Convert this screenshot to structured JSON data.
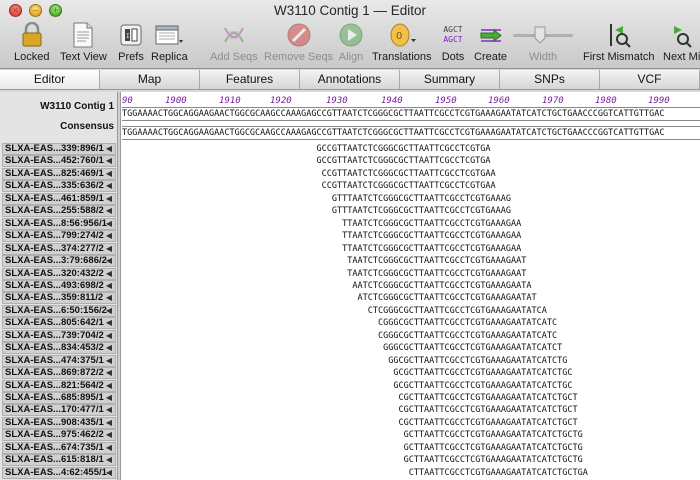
{
  "window": {
    "title": "W3110 Contig 1 — Editor"
  },
  "toolbar": [
    {
      "id": "locked",
      "label": "Locked",
      "icon": "lock-icon",
      "enabled": true
    },
    {
      "id": "text-view",
      "label": "Text View",
      "icon": "document-icon",
      "enabled": true
    },
    {
      "id": "prefs",
      "label": "Prefs",
      "icon": "switch-icon",
      "enabled": true
    },
    {
      "id": "replica",
      "label": "Replica",
      "icon": "replica-window-icon",
      "enabled": true
    },
    {
      "id": "add-seqs",
      "label": "Add Seqs",
      "icon": "add-sequences-icon",
      "enabled": false
    },
    {
      "id": "remove-seqs",
      "label": "Remove Seqs",
      "icon": "remove-sequences-icon",
      "enabled": false
    },
    {
      "id": "align",
      "label": "Align",
      "icon": "play-icon",
      "enabled": false
    },
    {
      "id": "translations",
      "label": "Translations",
      "icon": "translation-icon",
      "enabled": true
    },
    {
      "id": "dots",
      "label": "Dots",
      "icon": "agct-dots-icon",
      "enabled": true,
      "icon_text": "AGCT",
      "icon_text2": "AGCT"
    },
    {
      "id": "create",
      "label": "Create",
      "icon": "create-arrow-icon",
      "enabled": true
    },
    {
      "id": "width",
      "label": "Width",
      "icon": "width-slider-icon",
      "enabled": false
    },
    {
      "id": "first-mismatch",
      "label": "First Mismatch",
      "icon": "first-mismatch-icon",
      "enabled": true
    },
    {
      "id": "next-mismatch",
      "label": "Next Mi",
      "icon": "next-mismatch-icon",
      "enabled": true
    }
  ],
  "tabs": [
    "Editor",
    "Map",
    "Features",
    "Annotations",
    "Summary",
    "SNPs",
    "VCF"
  ],
  "active_tab": "Editor",
  "contig": {
    "name": "W3110 Contig 1",
    "consensus_label": "Consensus",
    "ruler": [
      "90",
      "1900",
      "1910",
      "1920",
      "1930",
      "1940",
      "1950",
      "1960",
      "1970",
      "1980",
      "1990"
    ],
    "reference": "TGGAAAACTGGCAGGAAGAACTGGCGCAAGCCAAAGAGCCGTTAATCTCGGGCGCTTAATTCGCCTCGTGAAAGAATATCATCTGCTGAACCCGGTCATTGTTGAC",
    "consensus": "TGGAAAACTGGCAGGAAGAACTGGCGCAAGCCAAAGAGCCGTTAATCTCGGGCGCTTAATTCGCCTCGTGAAAGAATATCATCTGCTGAACCCGGTCATTGTTGAC"
  },
  "reads": [
    {
      "name": "SLXA-EAS...339:896/1",
      "offset": 38,
      "seq": "GCCGTTAATCTCGGGCGCTTAATTCGCCTCGTGA"
    },
    {
      "name": "SLXA-EAS...452:760/1",
      "offset": 38,
      "seq": "GCCGTTAATCTCGGGCGCTTAATTCGCCTCGTGA"
    },
    {
      "name": "SLXA-EAS...825:469/1",
      "offset": 39,
      "seq": "CCGTTAATCTCGGGCGCTTAATTCGCCTCGTGAA"
    },
    {
      "name": "SLXA-EAS...335:636/2",
      "offset": 39,
      "seq": "CCGTTAATCTCGGGCGCTTAATTCGCCTCGTGAA"
    },
    {
      "name": "SLXA-EAS...461:859/1",
      "offset": 41,
      "seq": "GTTTAATCTCGGGCGCTTAATTCGCCTCGTGAAAG"
    },
    {
      "name": "SLXA-EAS...255:588/2",
      "offset": 41,
      "seq": "GTTTAATCTCGGGCGCTTAATTCGCCTCGTGAAAG"
    },
    {
      "name": "SLXA-EAS...8:56:956/1",
      "offset": 43,
      "seq": "TTAATCTCGGGCGCTTAATTCGCCTCGTGAAAGAA"
    },
    {
      "name": "SLXA-EAS...799:274/2",
      "offset": 43,
      "seq": "TTAATCTCGGGCGCTTAATTCGCCTCGTGAAAGAA"
    },
    {
      "name": "SLXA-EAS...374:277/2",
      "offset": 43,
      "seq": "TTAATCTCGGGCGCTTAATTCGCCTCGTGAAAGAA"
    },
    {
      "name": "SLXA-EAS...3:79:686/2",
      "offset": 44,
      "seq": "TAATCTCGGGCGCTTAATTCGCCTCGTGAAAGAAT"
    },
    {
      "name": "SLXA-EAS...320:432/2",
      "offset": 44,
      "seq": "TAATCTCGGGCGCTTAATTCGCCTCGTGAAAGAAT"
    },
    {
      "name": "SLXA-EAS...493:698/2",
      "offset": 45,
      "seq": "AATCTCGGGCGCTTAATTCGCCTCGTGAAAGAATA"
    },
    {
      "name": "SLXA-EAS...359:811/2",
      "offset": 46,
      "seq": "ATCTCGGGCGCTTAATTCGCCTCGTGAAAGAATAT"
    },
    {
      "name": "SLXA-EAS...6:50:156/2",
      "offset": 48,
      "seq": "CTCGGGCGCTTAATTCGCCTCGTGAAAGAATATCA"
    },
    {
      "name": "SLXA-EAS...805:642/1",
      "offset": 50,
      "seq": "CGGGCGCTTAATTCGCCTCGTGAAAGAATATCATC"
    },
    {
      "name": "SLXA-EAS...739:704/2",
      "offset": 50,
      "seq": "CGGGCGCTTAATTCGCCTCGTGAAAGAATATCATC"
    },
    {
      "name": "SLXA-EAS...834:453/2",
      "offset": 51,
      "seq": "GGGCGCTTAATTCGCCTCGTGAAAGAATATCATCT"
    },
    {
      "name": "SLXA-EAS...474:375/1",
      "offset": 52,
      "seq": "GGCGCTTAATTCGCCTCGTGAAAGAATATCATCTG"
    },
    {
      "name": "SLXA-EAS...869:872/2",
      "offset": 53,
      "seq": "GCGCTTAATTCGCCTCGTGAAAGAATATCATCTGC"
    },
    {
      "name": "SLXA-EAS...821:564/2",
      "offset": 53,
      "seq": "GCGCTTAATTCGCCTCGTGAAAGAATATCATCTGC"
    },
    {
      "name": "SLXA-EAS...685:895/1",
      "offset": 54,
      "seq": "CGCTTAATTCGCCTCGTGAAAGAATATCATCTGCT"
    },
    {
      "name": "SLXA-EAS...170:477/1",
      "offset": 54,
      "seq": "CGCTTAATTCGCCTCGTGAAAGAATATCATCTGCT"
    },
    {
      "name": "SLXA-EAS...908:435/1",
      "offset": 54,
      "seq": "CGCTTAATTCGCCTCGTGAAAGAATATCATCTGCT"
    },
    {
      "name": "SLXA-EAS...975:462/2",
      "offset": 55,
      "seq": "GCTTAATTCGCCTCGTGAAAGAATATCATCTGCTG"
    },
    {
      "name": "SLXA-EAS...674:735/1",
      "offset": 55,
      "seq": "GCTTAATTCGCCTCGTGAAAGAATATCATCTGCTG"
    },
    {
      "name": "SLXA-EAS...615:818/1",
      "offset": 55,
      "seq": "GCTTAATTCGCCTCGTGAAAGAATATCATCTGCTG"
    },
    {
      "name": "SLXA-EAS...4:62:455/1",
      "offset": 56,
      "seq": "CTTAATTCGCCTCGTGAAAGAATATCATCTGCTGA"
    }
  ]
}
